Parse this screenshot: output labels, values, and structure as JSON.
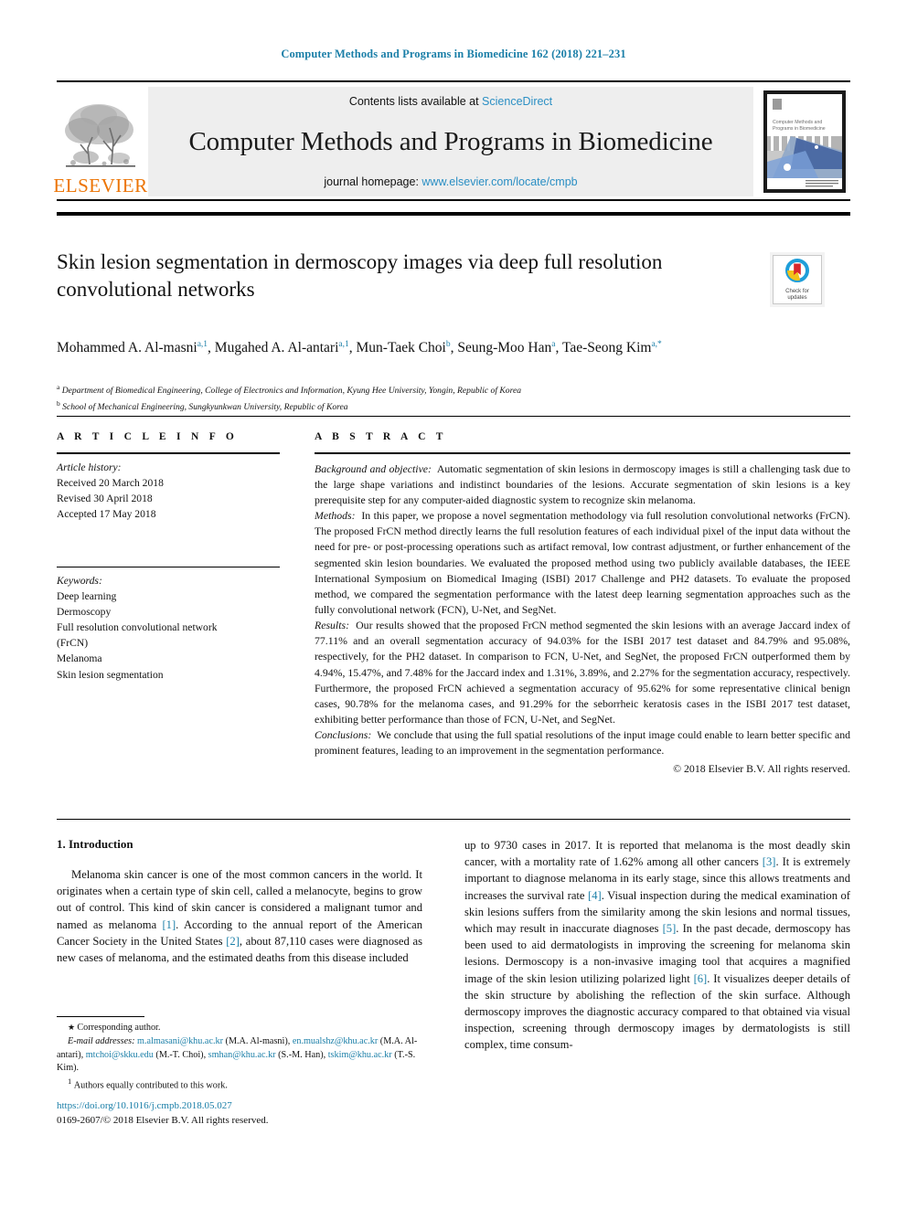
{
  "running_head": "Computer Methods and Programs in Biomedicine 162 (2018) 221–231",
  "masthead": {
    "publisher": "ELSEVIER",
    "contents_prefix": "Contents lists available at ",
    "contents_link": "ScienceDirect",
    "journal_name": "Computer Methods and Programs in Biomedicine",
    "homepage_prefix": "journal homepage: ",
    "homepage_url": "www.elsevier.com/locate/cmpb",
    "cover_title": "Computer Methods and Programs in Biomedicine"
  },
  "article": {
    "title": "Skin lesion segmentation in dermoscopy images via deep full resolution convolutional networks",
    "crossmark_line1": "Check for",
    "crossmark_line2": "updates",
    "authors_html": "Mohammed A. Al-masni<sup>a,1</sup>, Mugahed A. Al-antari<sup>a,1</sup>, Mun-Taek Choi<sup>b</sup>, Seung-Moo Han<sup>a</sup>, Tae-Seong Kim<sup>a,*</sup>",
    "affiliation_a": "Department of Biomedical Engineering, College of Electronics and Information, Kyung Hee University, Yongin, Republic of Korea",
    "affiliation_b": "School of Mechanical Engineering, Sungkyunkwan University, Republic of Korea"
  },
  "article_info": {
    "heading": "A R T I C L E   I N F O",
    "history_label": "Article history:",
    "received": "Received 20 March 2018",
    "revised": "Revised 30 April 2018",
    "accepted": "Accepted 17 May 2018",
    "keywords_label": "Keywords:",
    "keywords": [
      "Deep learning",
      "Dermoscopy",
      "Full resolution convolutional network",
      "(FrCN)",
      "Melanoma",
      "Skin lesion segmentation"
    ]
  },
  "abstract": {
    "heading": "A B S T R A C T",
    "background_label": "Background and objective:",
    "background_text": "Automatic segmentation of skin lesions in dermoscopy images is still a challenging task due to the large shape variations and indistinct boundaries of the lesions. Accurate segmentation of skin lesions is a key prerequisite step for any computer-aided diagnostic system to recognize skin melanoma.",
    "methods_label": "Methods:",
    "methods_text": "In this paper, we propose a novel segmentation methodology via full resolution convolutional networks (FrCN). The proposed FrCN method directly learns the full resolution features of each individual pixel of the input data without the need for pre- or post-processing operations such as artifact removal, low contrast adjustment, or further enhancement of the segmented skin lesion boundaries. We evaluated the proposed method using two publicly available databases, the IEEE International Symposium on Biomedical Imaging (ISBI) 2017 Challenge and PH2 datasets. To evaluate the proposed method, we compared the segmentation performance with the latest deep learning segmentation approaches such as the fully convolutional network (FCN), U-Net, and SegNet.",
    "results_label": "Results:",
    "results_text": "Our results showed that the proposed FrCN method segmented the skin lesions with an average Jaccard index of 77.11% and an overall segmentation accuracy of 94.03% for the ISBI 2017 test dataset and 84.79% and 95.08%, respectively, for the PH2 dataset. In comparison to FCN, U-Net, and SegNet, the proposed FrCN outperformed them by 4.94%, 15.47%, and 7.48% for the Jaccard index and 1.31%, 3.89%, and 2.27% for the segmentation accuracy, respectively. Furthermore, the proposed FrCN achieved a segmentation accuracy of 95.62% for some representative clinical benign cases, 90.78% for the melanoma cases, and 91.29% for the seborrheic keratosis cases in the ISBI 2017 test dataset, exhibiting better performance than those of FCN, U-Net, and SegNet.",
    "conclusions_label": "Conclusions:",
    "conclusions_text": "We conclude that using the full spatial resolutions of the input image could enable to learn better specific and prominent features, leading to an improvement in the segmentation performance.",
    "copyright": "© 2018 Elsevier B.V. All rights reserved."
  },
  "body": {
    "section_heading": "1. Introduction",
    "left_para_html": "Melanoma skin cancer is one of the most common cancers in the world. It originates when a certain type of skin cell, called a melanocyte, begins to grow out of control. This kind of skin cancer is considered a malignant tumor and named as melanoma <span class=\"ref\">[1]</span>. According to the annual report of the American Cancer Society in the United States <span class=\"ref\">[2]</span>, about 87,110 cases were diagnosed as new cases of melanoma, and the estimated deaths from this disease included",
    "right_para_html": "up to 9730 cases in 2017. It is reported that melanoma is the most deadly skin cancer, with a mortality rate of 1.62% among all other cancers <span class=\"ref\">[3]</span>. It is extremely important to diagnose melanoma in its early stage, since this allows treatments and increases the survival rate <span class=\"ref\">[4]</span>. Visual inspection during the medical examination of skin lesions suffers from the similarity among the skin lesions and normal tissues, which may result in inaccurate diagnoses <span class=\"ref\">[5]</span>. In the past decade, dermoscopy has been used to aid dermatologists in improving the screening for melanoma skin lesions. Dermoscopy is a non-invasive imaging tool that acquires a magnified image of the skin lesion utilizing polarized light <span class=\"ref\">[6]</span>. It visualizes deeper details of the skin structure by abolishing the reflection of the skin surface. Although dermoscopy improves the diagnostic accuracy compared to that obtained via visual inspection, screening through dermoscopy images by dermatologists is still complex, time consum-"
  },
  "footnotes": {
    "corresponding": "Corresponding author.",
    "email_label": "E-mail addresses:",
    "emails_html": "<span class=\"mail\">m.almasani@khu.ac.kr</span> (M.A. Al-masni), <span class=\"mail\">en.mualshz@khu.ac.kr</span> (M.A. Al-antari), <span class=\"mail\">mtchoi@skku.edu</span> (M.-T. Choi), <span class=\"mail\">smhan@khu.ac.kr</span> (S.-M. Han), <span class=\"mail\">tskim@khu.ac.kr</span> (T.-S. Kim).",
    "equal_contrib": "Authors equally contributed to this work.",
    "doi": "https://doi.org/10.1016/j.cmpb.2018.05.027",
    "issn_line": "0169-2607/© 2018 Elsevier B.V. All rights reserved."
  },
  "colors": {
    "link": "#1b7fa8",
    "elsevier_orange": "#ec7404",
    "band_gray": "#eeeeee"
  }
}
